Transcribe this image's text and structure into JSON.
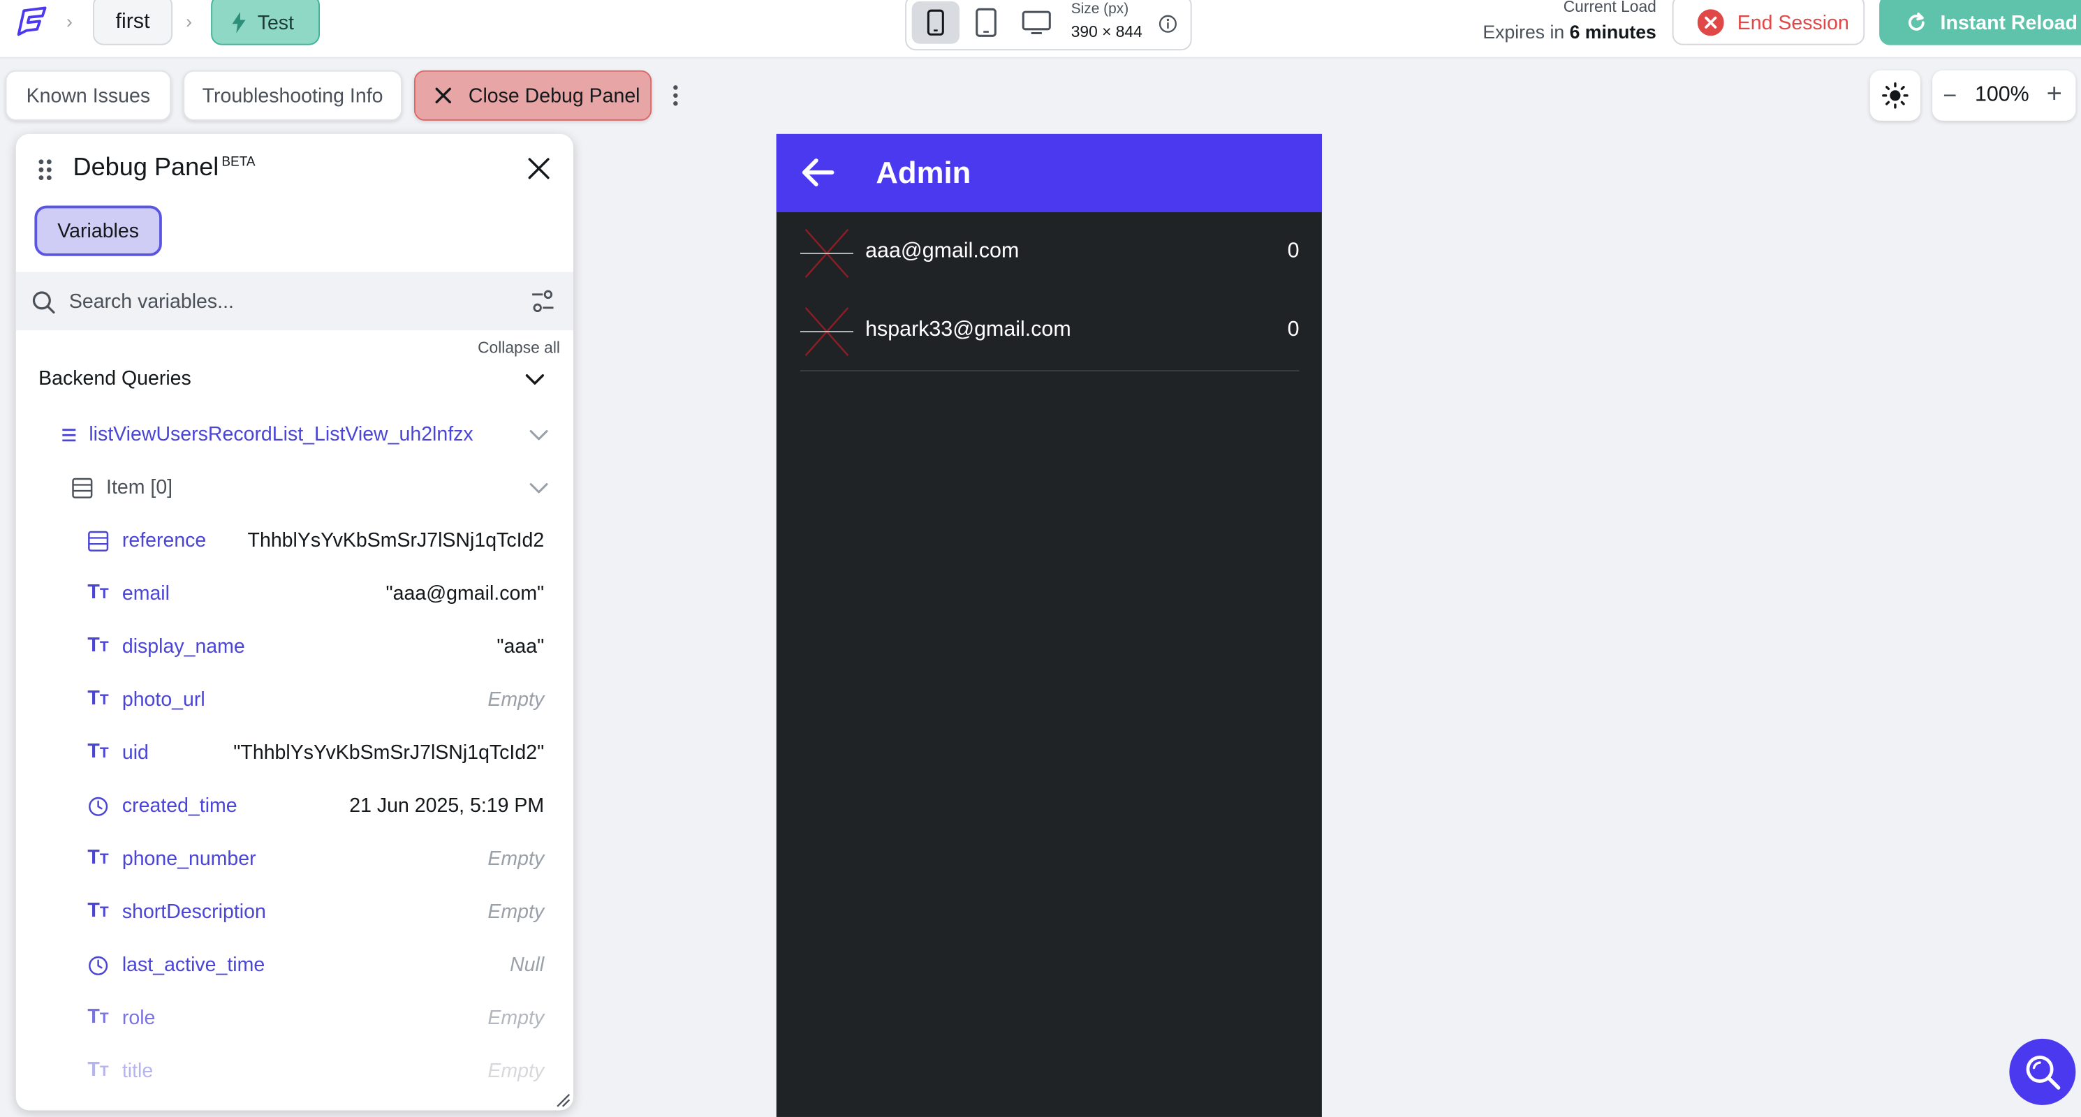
{
  "topbar": {
    "breadcrumb_first": "first",
    "breadcrumb_test": "Test",
    "size_label": "Size (px)",
    "size_value": "390 × 844",
    "load_label": "Current Load",
    "expires_prefix": "Expires in",
    "expires_value": "6 minutes",
    "end_session_label": "End Session",
    "instant_reload_label": "Instant Reload"
  },
  "toolbar": {
    "known_issues_label": "Known Issues",
    "troubleshooting_label": "Troubleshooting Info",
    "close_debug_label": "Close Debug Panel",
    "zoom_value": "100%"
  },
  "debug_panel": {
    "title": "Debug Panel",
    "beta": "BETA",
    "variables_tab": "Variables",
    "search_placeholder": "Search variables...",
    "collapse_all": "Collapse all",
    "section_label": "Backend Queries",
    "list_label": "listViewUsersRecordList_ListView_uh2lnfzx",
    "item_label": "Item [0]",
    "variables": [
      {
        "name": "reference",
        "value": "ThhblYsYvKbSmSrJ7lSNj1qTcId2",
        "icon": "document-ref-icon",
        "muted": false
      },
      {
        "name": "email",
        "value": "\"aaa@gmail.com\"",
        "icon": "text-type-icon",
        "muted": false
      },
      {
        "name": "display_name",
        "value": "\"aaa\"",
        "icon": "text-type-icon",
        "muted": false
      },
      {
        "name": "photo_url",
        "value": "Empty",
        "icon": "text-type-icon",
        "muted": true
      },
      {
        "name": "uid",
        "value": "\"ThhblYsYvKbSmSrJ7lSNj1qTcId2\"",
        "icon": "text-type-icon",
        "muted": false
      },
      {
        "name": "created_time",
        "value": "21 Jun 2025, 5:19 PM",
        "icon": "clock-icon",
        "muted": false
      },
      {
        "name": "phone_number",
        "value": "Empty",
        "icon": "text-type-icon",
        "muted": true
      },
      {
        "name": "shortDescription",
        "value": "Empty",
        "icon": "text-type-icon",
        "muted": true
      },
      {
        "name": "last_active_time",
        "value": "Null",
        "icon": "clock-icon",
        "muted": true
      },
      {
        "name": "role",
        "value": "Empty",
        "icon": "text-type-icon",
        "muted": true
      },
      {
        "name": "title",
        "value": "Empty",
        "icon": "text-type-icon",
        "muted": true
      }
    ]
  },
  "phone": {
    "title": "Admin",
    "users": [
      {
        "email": "aaa@gmail.com",
        "count": "0"
      },
      {
        "email": "hspark33@gmail.com",
        "count": "0"
      }
    ]
  },
  "colors": {
    "brand_primary": "#4b39ef",
    "accent_teal": "#5fc2aa",
    "danger": "#e04848",
    "phone_background": "#1f2326"
  }
}
